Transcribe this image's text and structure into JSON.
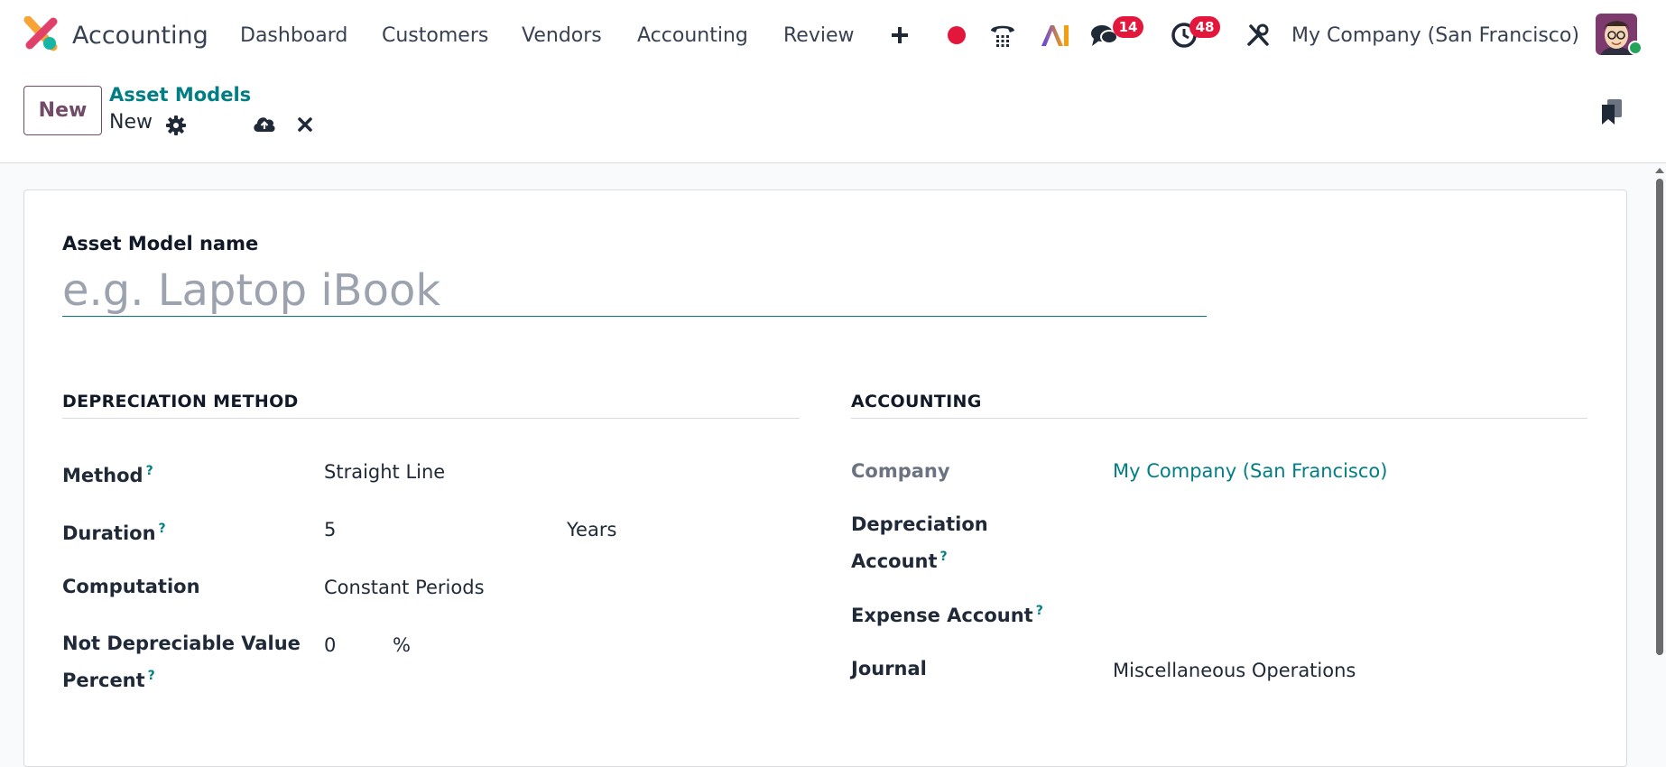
{
  "navbar": {
    "app_name": "Accounting",
    "menu": [
      {
        "label": "Dashboard"
      },
      {
        "label": "Customers"
      },
      {
        "label": "Vendors"
      },
      {
        "label": "Accounting"
      },
      {
        "label": "Review"
      }
    ],
    "icons": [
      "plus-icon",
      "record-icon",
      "phone-icon",
      "ai-icon",
      "chat-icon",
      "activity-clock-icon",
      "tools-icon"
    ],
    "chat_count": "14",
    "activity_count": "48",
    "company": "My Company (San Francisco)",
    "colors": {
      "badge": "#e3173c",
      "record": "#e3173c",
      "presence": "#22a55a"
    }
  },
  "control_panel": {
    "new_button": "New",
    "breadcrumb": "Asset Models",
    "record_name": "New",
    "icons": [
      "gear-icon",
      "save-cloud-icon",
      "discard-icon",
      "bookmark-icon"
    ]
  },
  "form": {
    "name_label": "Asset Model name",
    "name_placeholder": "e.g. Laptop iBook",
    "name_value": "",
    "depreciation": {
      "title": "DEPRECIATION METHOD",
      "method_label": "Method",
      "method_value": "Straight Line",
      "duration_label": "Duration",
      "duration_value": "5",
      "duration_unit": "Years",
      "computation_label": "Computation",
      "computation_value": "Constant Periods",
      "not_depreciable_label_1": "Not Depreciable Value",
      "not_depreciable_label_2": "Percent",
      "not_depreciable_value": "0",
      "not_depreciable_unit": "%"
    },
    "accounting": {
      "title": "ACCOUNTING",
      "company_label": "Company",
      "company_value": "My Company (San Francisco)",
      "depreciation_account_label_1": "Depreciation",
      "depreciation_account_label_2": "Account",
      "depreciation_account_value": "",
      "expense_account_label": "Expense Account",
      "expense_account_value": "",
      "journal_label": "Journal",
      "journal_value": "Miscellaneous Operations"
    },
    "help_mark": "?"
  },
  "theme": {
    "primary": "#714b67",
    "link": "#017e84"
  }
}
